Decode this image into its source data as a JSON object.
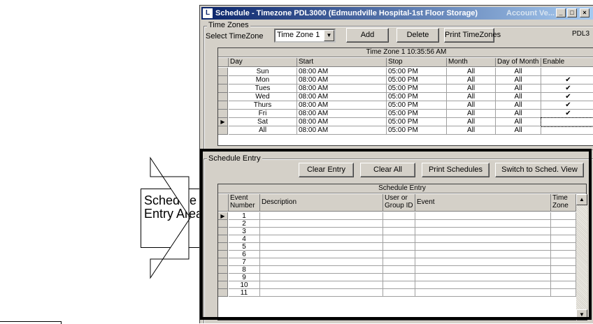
{
  "callout": {
    "line1": "Schedule",
    "line2": "Entry Area"
  },
  "window": {
    "title": "Schedule - Timezone  PDL3000 (Edmundville Hospital-1st Floor Storage)",
    "title_right": "Account Ve...",
    "minimize": "_",
    "maximize": "□",
    "close": "×"
  },
  "timezones": {
    "group_label": "Time Zones",
    "select_label": "Select TimeZone",
    "selected": "Time Zone 1",
    "add": "Add",
    "delete": "Delete",
    "print": "Print TimeZones",
    "right_tag": "PDL3",
    "caption": "Time Zone 1  10:35:56 AM",
    "columns": [
      "Day",
      "Start",
      "Stop",
      "Month",
      "Day of Month",
      "Enable"
    ],
    "rows": [
      {
        "day": "Sun",
        "start": "08:00 AM",
        "stop": "05:00 PM",
        "month": "All",
        "dom": "All",
        "enable": ""
      },
      {
        "day": "Mon",
        "start": "08:00 AM",
        "stop": "05:00 PM",
        "month": "All",
        "dom": "All",
        "enable": "✔"
      },
      {
        "day": "Tues",
        "start": "08:00 AM",
        "stop": "05:00 PM",
        "month": "All",
        "dom": "All",
        "enable": "✔"
      },
      {
        "day": "Wed",
        "start": "08:00 AM",
        "stop": "05:00 PM",
        "month": "All",
        "dom": "All",
        "enable": "✔"
      },
      {
        "day": "Thurs",
        "start": "08:00 AM",
        "stop": "05:00 PM",
        "month": "All",
        "dom": "All",
        "enable": "✔"
      },
      {
        "day": "Fri",
        "start": "08:00 AM",
        "stop": "05:00 PM",
        "month": "All",
        "dom": "All",
        "enable": "✔"
      },
      {
        "day": "Sat",
        "start": "08:00 AM",
        "stop": "05:00 PM",
        "month": "All",
        "dom": "All",
        "enable": ""
      },
      {
        "day": "All",
        "start": "08:00 AM",
        "stop": "05:00 PM",
        "month": "All",
        "dom": "All",
        "enable": ""
      }
    ],
    "current_row_marker": "▶"
  },
  "schedule": {
    "group_label": "Schedule Entry",
    "clear_entry": "Clear Entry",
    "clear_all": "Clear All",
    "print_schedules": "Print Schedules",
    "switch_view": "Switch to Sched. View",
    "caption": "Schedule Entry",
    "col_event_number": "Event Number",
    "col_description": "Description",
    "col_user": "User or Group ID",
    "col_event": "Event",
    "col_timezone": "Time Zone",
    "event_numbers": [
      "1",
      "2",
      "3",
      "4",
      "5",
      "6",
      "7",
      "8",
      "9",
      "10",
      "11"
    ],
    "current_row_marker": "▶",
    "scroll_up": "▲",
    "scroll_down": "▼"
  }
}
